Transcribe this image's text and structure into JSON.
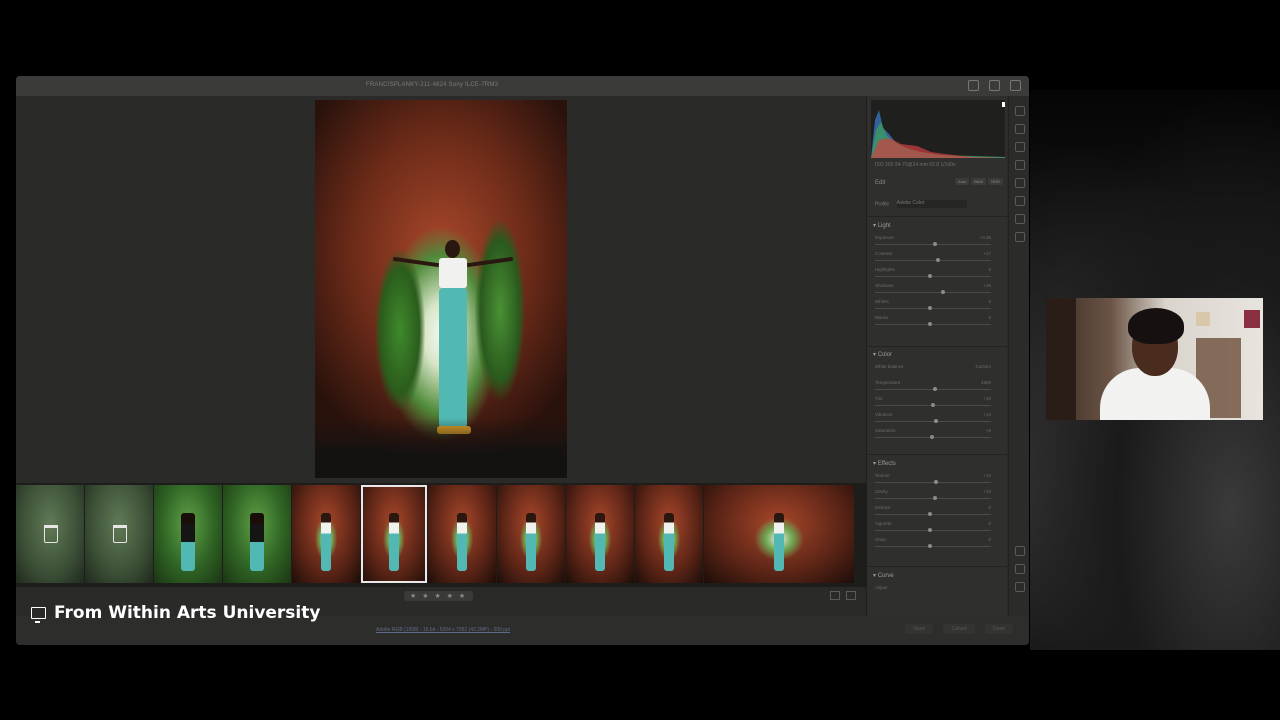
{
  "app": {
    "title": "FRANCISPLANKY-211-4824   Sony ILCE-7RM3",
    "colors": {
      "accent": "#e8e8e8",
      "panel": "#2f2f2d",
      "canvas": "#2a2a28",
      "link": "#5d6b8a"
    }
  },
  "histogram": {
    "info": "ISO 200     24-70@24 mm     f/2.8     1/160s"
  },
  "edit": {
    "title": "Edit",
    "buttons": [
      "Auto",
      "B&W",
      "HDR"
    ],
    "profile_label": "Profile",
    "profile_value": "Adobe Color"
  },
  "light": {
    "title": "Light",
    "sliders": [
      {
        "label": "Exposure",
        "value": "+0.35",
        "position": 0.55
      },
      {
        "label": "Contrast",
        "value": "+17",
        "position": 0.58
      },
      {
        "label": "Highlights",
        "value": "0",
        "position": 0.5
      },
      {
        "label": "Shadows",
        "value": "+25",
        "position": 0.62
      },
      {
        "label": "Whites",
        "value": "0",
        "position": 0.5
      },
      {
        "label": "Blacks",
        "value": "0",
        "position": 0.5
      }
    ]
  },
  "color": {
    "title": "Color",
    "wb_label": "White balance",
    "wb_value": "Custom",
    "sliders": [
      {
        "label": "Temperature",
        "value": "4850",
        "position": 0.55
      },
      {
        "label": "Tint",
        "value": "+10",
        "position": 0.53
      },
      {
        "label": "Vibrance",
        "value": "+14",
        "position": 0.56
      },
      {
        "label": "Saturation",
        "value": "+6",
        "position": 0.52
      }
    ]
  },
  "effects": {
    "title": "Effects",
    "sliders": [
      {
        "label": "Texture",
        "value": "+12",
        "position": 0.56
      },
      {
        "label": "Clarity",
        "value": "+10",
        "position": 0.55
      },
      {
        "label": "Dehaze",
        "value": "0",
        "position": 0.5
      },
      {
        "label": "Vignette",
        "value": "0",
        "position": 0.5
      },
      {
        "label": "Grain",
        "value": "0",
        "position": 0.5
      }
    ]
  },
  "curve": {
    "title": "Curve",
    "adjust_label": "Adjust"
  },
  "filmstrip": {
    "thumbs": [
      {
        "kind": "dim",
        "trash": true
      },
      {
        "kind": "dim",
        "trash": true
      },
      {
        "kind": "leaf",
        "figure": "dark"
      },
      {
        "kind": "leaf",
        "figure": "dark"
      },
      {
        "kind": "cave",
        "figure": "light"
      },
      {
        "kind": "cave",
        "figure": "light",
        "selected": true
      },
      {
        "kind": "cave",
        "figure": "light"
      },
      {
        "kind": "cave",
        "figure": "light"
      },
      {
        "kind": "cave",
        "figure": "light"
      },
      {
        "kind": "cave",
        "figure": "light"
      },
      {
        "kind": "cave",
        "figure": "light"
      }
    ]
  },
  "rating": {
    "stars": "★ ★ ★ ★ ★",
    "count": 0
  },
  "status": {
    "meta": "Adobe RGB (1998) - 16 bit - 5304 x 7952 (42.2MP) - 300 ppi",
    "buttons": [
      "Open",
      "Cancel",
      "Done"
    ]
  },
  "caption": {
    "text": "From Within Arts University",
    "icon": "monitor-icon"
  }
}
